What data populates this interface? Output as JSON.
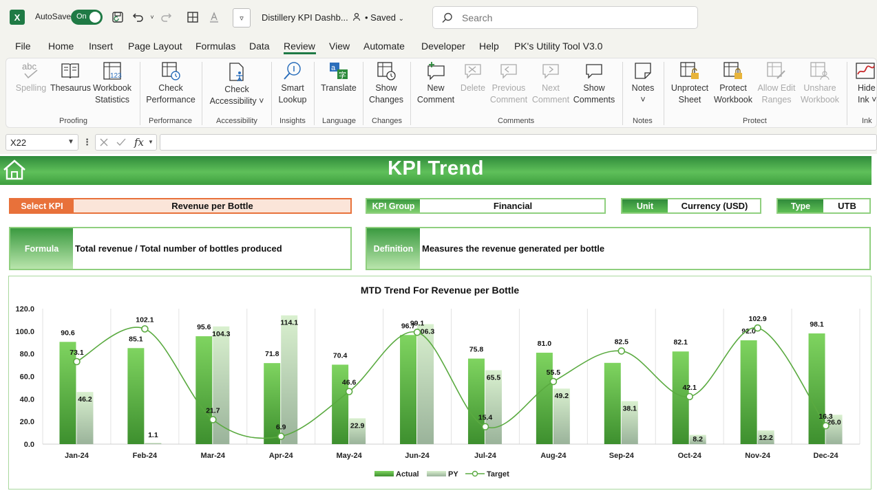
{
  "titlebar": {
    "app_icon": "X",
    "autosave_label": "AutoSave",
    "toggle_label": "On",
    "doc_title": "Distillery KPI Dashb...",
    "saved_label": "• Saved",
    "search_placeholder": "Search"
  },
  "menu": [
    "File",
    "Home",
    "Insert",
    "Page Layout",
    "Formulas",
    "Data",
    "Review",
    "View",
    "Automate",
    "Developer",
    "Help",
    "PK's Utility Tool V3.0"
  ],
  "ribbon": {
    "buttons": [
      {
        "l1": "abc",
        "l2": "Spelling",
        "dim": true
      },
      {
        "l1": "Thesaurus",
        "l2": ""
      },
      {
        "l1": "Workbook",
        "l2": "Statistics"
      },
      {
        "l1": "Check",
        "l2": "Performance"
      },
      {
        "l1": "Check",
        "l2": "Accessibility ˅"
      },
      {
        "l1": "Smart",
        "l2": "Lookup"
      },
      {
        "l1": "Translate",
        "l2": ""
      },
      {
        "l1": "Show",
        "l2": "Changes"
      },
      {
        "l1": "New",
        "l2": "Comment"
      },
      {
        "l1": "Delete",
        "l2": "",
        "dim": true
      },
      {
        "l1": "Previous",
        "l2": "Comment",
        "dim": true
      },
      {
        "l1": "Next",
        "l2": "Comment",
        "dim": true
      },
      {
        "l1": "Show",
        "l2": "Comments"
      },
      {
        "l1": "Notes",
        "l2": "˅"
      },
      {
        "l1": "Unprotect",
        "l2": "Sheet"
      },
      {
        "l1": "Protect",
        "l2": "Workbook"
      },
      {
        "l1": "Allow Edit",
        "l2": "Ranges",
        "dim": true
      },
      {
        "l1": "Unshare",
        "l2": "Workbook",
        "dim": true
      },
      {
        "l1": "Hide",
        "l2": "Ink ˅"
      }
    ],
    "groups": [
      "Proofing",
      "Performance",
      "Accessibility",
      "Insights",
      "Language",
      "Changes",
      "Comments",
      "Notes",
      "Protect",
      "Ink"
    ]
  },
  "formula_bar": {
    "name_box": "X22",
    "fx": "fx",
    "value": ""
  },
  "sheet": {
    "title": "KPI Trend",
    "select_kpi_label": "Select KPI",
    "select_kpi_value": "Revenue per Bottle",
    "kpi_group_label": "KPI Group",
    "kpi_group_value": "Financial",
    "unit_label": "Unit",
    "unit_value": "Currency (USD)",
    "type_label": "Type",
    "type_value": "UTB",
    "formula_label": "Formula",
    "formula_value": "Total revenue / Total number of bottles produced",
    "definition_label": "Definition",
    "definition_value": "Measures the revenue generated per bottle"
  },
  "colors": {
    "accent_green": "#1f7a45",
    "banner_green": "#4fb04a",
    "select_orange": "#e8713a",
    "select_fill": "#fbe5d9",
    "actual_green": "#5cb84a",
    "py_grey": "#b9c8b8",
    "target_line": "#5aaa40"
  },
  "chart_data": {
    "type": "bar",
    "title": "MTD Trend For Revenue per Bottle",
    "categories": [
      "Jan-24",
      "Feb-24",
      "Mar-24",
      "Apr-24",
      "May-24",
      "Jun-24",
      "Jul-24",
      "Aug-24",
      "Sep-24",
      "Oct-24",
      "Nov-24",
      "Dec-24"
    ],
    "series": [
      {
        "name": "Actual",
        "kind": "bar",
        "values": [
          90.6,
          85.1,
          95.6,
          71.8,
          70.4,
          96.7,
          75.8,
          81.0,
          72.0,
          82.1,
          92.0,
          98.1
        ]
      },
      {
        "name": "PY",
        "kind": "bar",
        "values": [
          46.2,
          1.1,
          104.3,
          114.1,
          22.9,
          106.3,
          65.5,
          49.2,
          38.1,
          8.2,
          12.2,
          26.0
        ]
      },
      {
        "name": "Target",
        "kind": "line",
        "values": [
          73.1,
          102.1,
          21.7,
          6.9,
          46.6,
          99.1,
          15.4,
          55.5,
          82.5,
          42.1,
          102.9,
          16.3
        ]
      }
    ],
    "actual_labels": [
      "90.6",
      "85.1",
      "95.6",
      "71.8",
      "70.4",
      "96.7",
      "75.8",
      "81.0",
      "",
      "82.1",
      "92.0",
      "98.1"
    ],
    "yticks": [
      "0.0",
      "20.0",
      "40.0",
      "60.0",
      "80.0",
      "100.0",
      "120.0"
    ],
    "ylim": [
      0,
      120
    ],
    "legend_position": "bottom",
    "grid": "vertical"
  }
}
